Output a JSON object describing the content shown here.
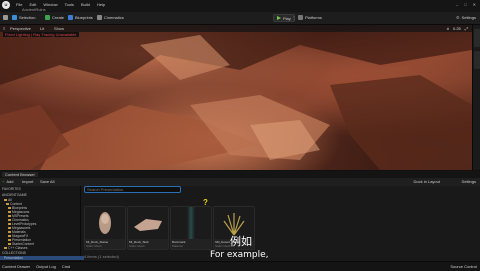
{
  "menu": {
    "items": [
      "File",
      "Edit",
      "Window",
      "Tools",
      "Build",
      "Help"
    ],
    "project": "AncientRuins"
  },
  "toolbar": {
    "save": "Save",
    "mode": "Selection",
    "create": "Create",
    "blueprints": "Blueprints",
    "cinematics": "Cinematics",
    "play": "Play",
    "platforms": "Platforms",
    "settings": "Settings"
  },
  "viewport": {
    "perspective": "Perspective",
    "lit": "Lit",
    "show": "Show",
    "warning": "Fixed Lighting | Ray Tracing Unavailable",
    "camera_speed": "0.25"
  },
  "content_browser": {
    "tab": "Content Browser",
    "add": "Add",
    "import": "Import",
    "save_all": "Save All",
    "dock_layout": "Dock in Layout",
    "settings": "Settings",
    "breadcrumb": "All  >  Content  >  Presentation",
    "search_placeholder": "Search Presentation",
    "favorites": "FAVORITES",
    "project_root": "ANCIENTGAME",
    "folders": [
      "All",
      "Content",
      "Blueprints",
      "Megascans",
      "MSPresets",
      "Cinematics",
      "LevelPrototypes",
      "Megaassets",
      "Materials",
      "NiagaraFX",
      "Presentation",
      "StarterContent",
      "C++ Classes"
    ],
    "collections": "COLLECTIONS",
    "selected_folder": "Presentation",
    "assets": [
      {
        "name": "MI_Rock_Statue",
        "type": "Static Mesh"
      },
      {
        "name": "MI_Rock_Slab",
        "type": "Static Mesh"
      },
      {
        "name": "Bookmark",
        "type": "Material"
      },
      {
        "name": "SM_Desert_Grass",
        "type": "Static Mesh"
      }
    ],
    "items_count": "4 items (1 selected)"
  },
  "statusbar": {
    "content_drawer": "Content Drawer",
    "output_log": "Output Log",
    "cmd": "Cmd",
    "source_control": "Source Control"
  },
  "subtitles": {
    "cn": "例如",
    "en": "For example,"
  },
  "colors": {
    "accent": "#2c6fb4",
    "play_green": "#6fcf4a",
    "warning_red": "#e24040",
    "folder": "#c79b3c"
  }
}
